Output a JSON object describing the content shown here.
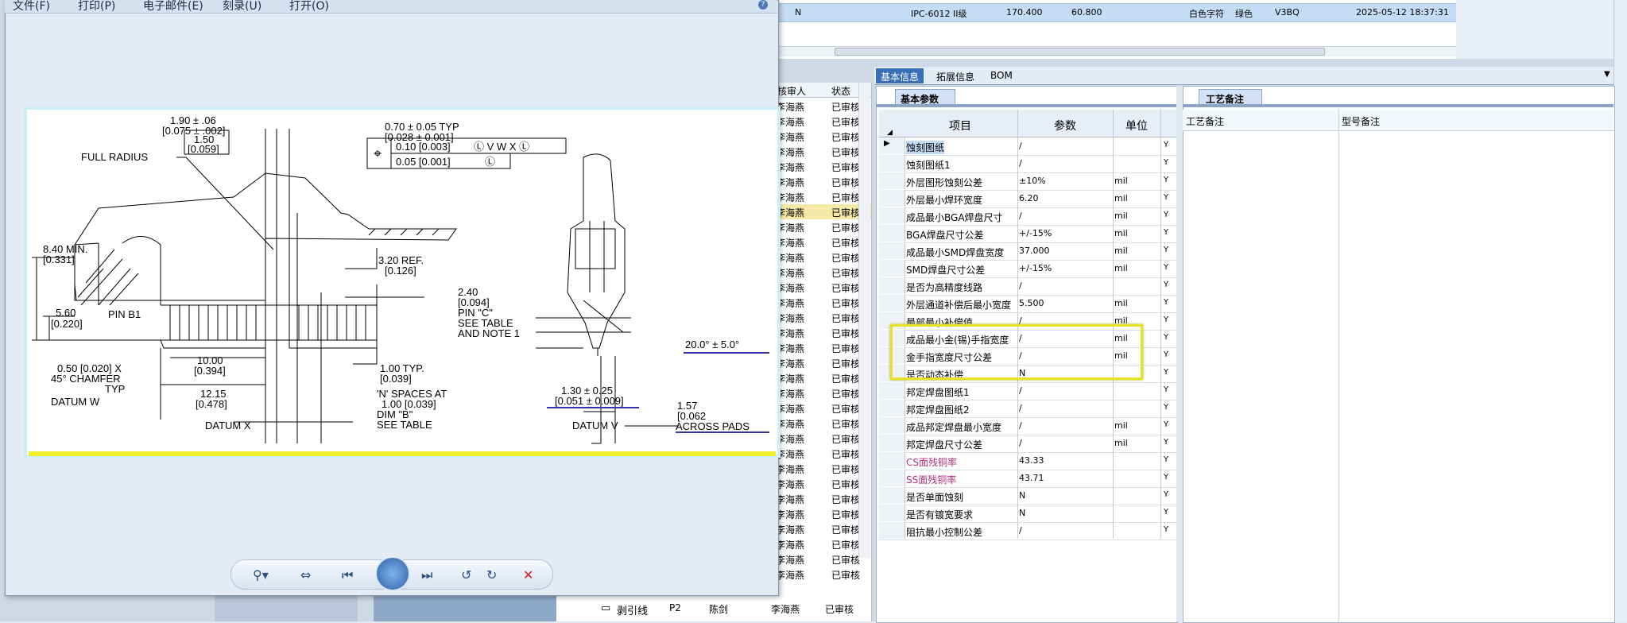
{
  "viewer": {
    "menu": [
      "文件(F)",
      "打印(P)",
      "电子邮件(E)",
      "刻录(U)",
      "打开(O)"
    ],
    "help": "?",
    "drawing_labels": {
      "d1": "1.90 ± .06",
      "d1b": "[0.075 ± .002]",
      "d2": "1.50",
      "d2b": "[0.059]",
      "d3": "0.70 ± 0.05 TYP",
      "d3b": "[0.028 ± 0.001]",
      "tol1": "0.10 [0.003]",
      "tol2": "0.05 [0.001]",
      "full_radius": "FULL RADIUS",
      "d4": "8.40 MIN.",
      "d4b": "[0.331]",
      "d5": "3.20 REF.",
      "d5b": "[0.126]",
      "d6": "2.40",
      "d6b": "[0.094]",
      "pinc": "PIN \"C\"",
      "seetable": "SEE TABLE",
      "note1": "AND NOTE 1",
      "d7": "5.60",
      "d7b": "[0.220]",
      "pinb1": "PIN B1",
      "d8": "10.00",
      "d8b": "[0.394]",
      "d9": "1.00 TYP.",
      "d9b": "[0.039]",
      "chamfer1": "0.50 [0.020] X",
      "chamfer2": "45° CHAMFER",
      "chamfer3": "TYP",
      "datumw": "DATUM W",
      "d10": "12.15",
      "d10b": "[0.478]",
      "nspaces1": "'N' SPACES AT",
      "nspaces2": "1.00 [0.039]",
      "dimb": "DIM \"B\"",
      "seetable2": "SEE TABLE",
      "datumx": "DATUM X",
      "angle": "20.0° ± 5.0°",
      "d11": "1.30 ± 0.25",
      "d11b": "[0.051 ± 0.009]",
      "d12": "1.57",
      "d12b": "[0.062",
      "acrosspads": "ACROSS PADS",
      "datumv": "DATUM V"
    }
  },
  "top_row": {
    "col1": "N",
    "grade": "IPC-6012 II级",
    "v1": "170.400",
    "v2": "60.800",
    "silk": "白色字符",
    "mask": "绿色",
    "code": "V3BQ",
    "time": "2025-05-12 18:37:31"
  },
  "list": {
    "headers": [
      "核审人",
      "状态"
    ],
    "name": "李海燕",
    "status": "已审核",
    "bottom": [
      {
        "name": "剥引线",
        "code": "P2",
        "user": "陈剑"
      }
    ]
  },
  "detail_tabs": [
    "基本信息",
    "拓展信息",
    "BOM"
  ],
  "basic_params": {
    "tab": "基本参数",
    "headers": {
      "item": "项目",
      "param": "参数",
      "unit": "单位"
    },
    "rows": [
      {
        "name": "蚀刻图纸",
        "value": "/",
        "unit": "",
        "flag": "Y"
      },
      {
        "name": "蚀刻图纸1",
        "value": "/",
        "unit": "",
        "flag": "Y"
      },
      {
        "name": "外层图形蚀刻公差",
        "value": "±10%",
        "unit": "mil",
        "flag": "Y"
      },
      {
        "name": "外层最小焊环宽度",
        "value": "6.20",
        "unit": "mil",
        "flag": "Y"
      },
      {
        "name": "成品最小BGA焊盘尺寸",
        "value": "/",
        "unit": "mil",
        "flag": "Y"
      },
      {
        "name": "BGA焊盘尺寸公差",
        "value": "+/-15%",
        "unit": "mil",
        "flag": "Y"
      },
      {
        "name": "成品最小SMD焊盘宽度",
        "value": "37.000",
        "unit": "mil",
        "flag": "Y"
      },
      {
        "name": "SMD焊盘尺寸公差",
        "value": "+/-15%",
        "unit": "mil",
        "flag": "Y"
      },
      {
        "name": "是否为高精度线路",
        "value": "/",
        "unit": "",
        "flag": "Y"
      },
      {
        "name": "外层通道补偿后最小宽度",
        "value": "5.500",
        "unit": "mil",
        "flag": "Y"
      },
      {
        "name": "最部最小补偿值",
        "value": "/",
        "unit": "mil",
        "flag": "Y"
      },
      {
        "name": "成品最小金(锡)手指宽度",
        "value": "/",
        "unit": "mil",
        "flag": "Y"
      },
      {
        "name": "金手指宽度尺寸公差",
        "value": "/",
        "unit": "mil",
        "flag": "Y"
      },
      {
        "name": "是否动态补偿",
        "value": "N",
        "unit": "",
        "flag": "Y"
      },
      {
        "name": "邦定焊盘图纸1",
        "value": "/",
        "unit": "",
        "flag": "Y"
      },
      {
        "name": "邦定焊盘图纸2",
        "value": "/",
        "unit": "",
        "flag": "Y"
      },
      {
        "name": "成品邦定焊盘最小宽度",
        "value": "/",
        "unit": "mil",
        "flag": "Y"
      },
      {
        "name": "邦定焊盘尺寸公差",
        "value": "/",
        "unit": "mil",
        "flag": "Y"
      },
      {
        "name": "CS面残铜率",
        "value": "43.33",
        "unit": "",
        "flag": "Y"
      },
      {
        "name": "SS面残铜率",
        "value": "43.71",
        "unit": "",
        "flag": "Y"
      },
      {
        "name": "是否单面蚀刻",
        "value": "N",
        "unit": "",
        "flag": "Y"
      },
      {
        "name": "是否有镀宽要求",
        "value": "N",
        "unit": "",
        "flag": "Y"
      },
      {
        "name": "阻抗最小控制公差",
        "value": "/",
        "unit": "",
        "flag": "Y"
      }
    ]
  },
  "craft_notes": {
    "tab": "工艺备注",
    "headers": [
      "工艺备注",
      "型号备注"
    ]
  },
  "colors": {
    "accent": "#3a6fb6",
    "highlight": "#e6e22a",
    "pink": "#b0307a"
  }
}
